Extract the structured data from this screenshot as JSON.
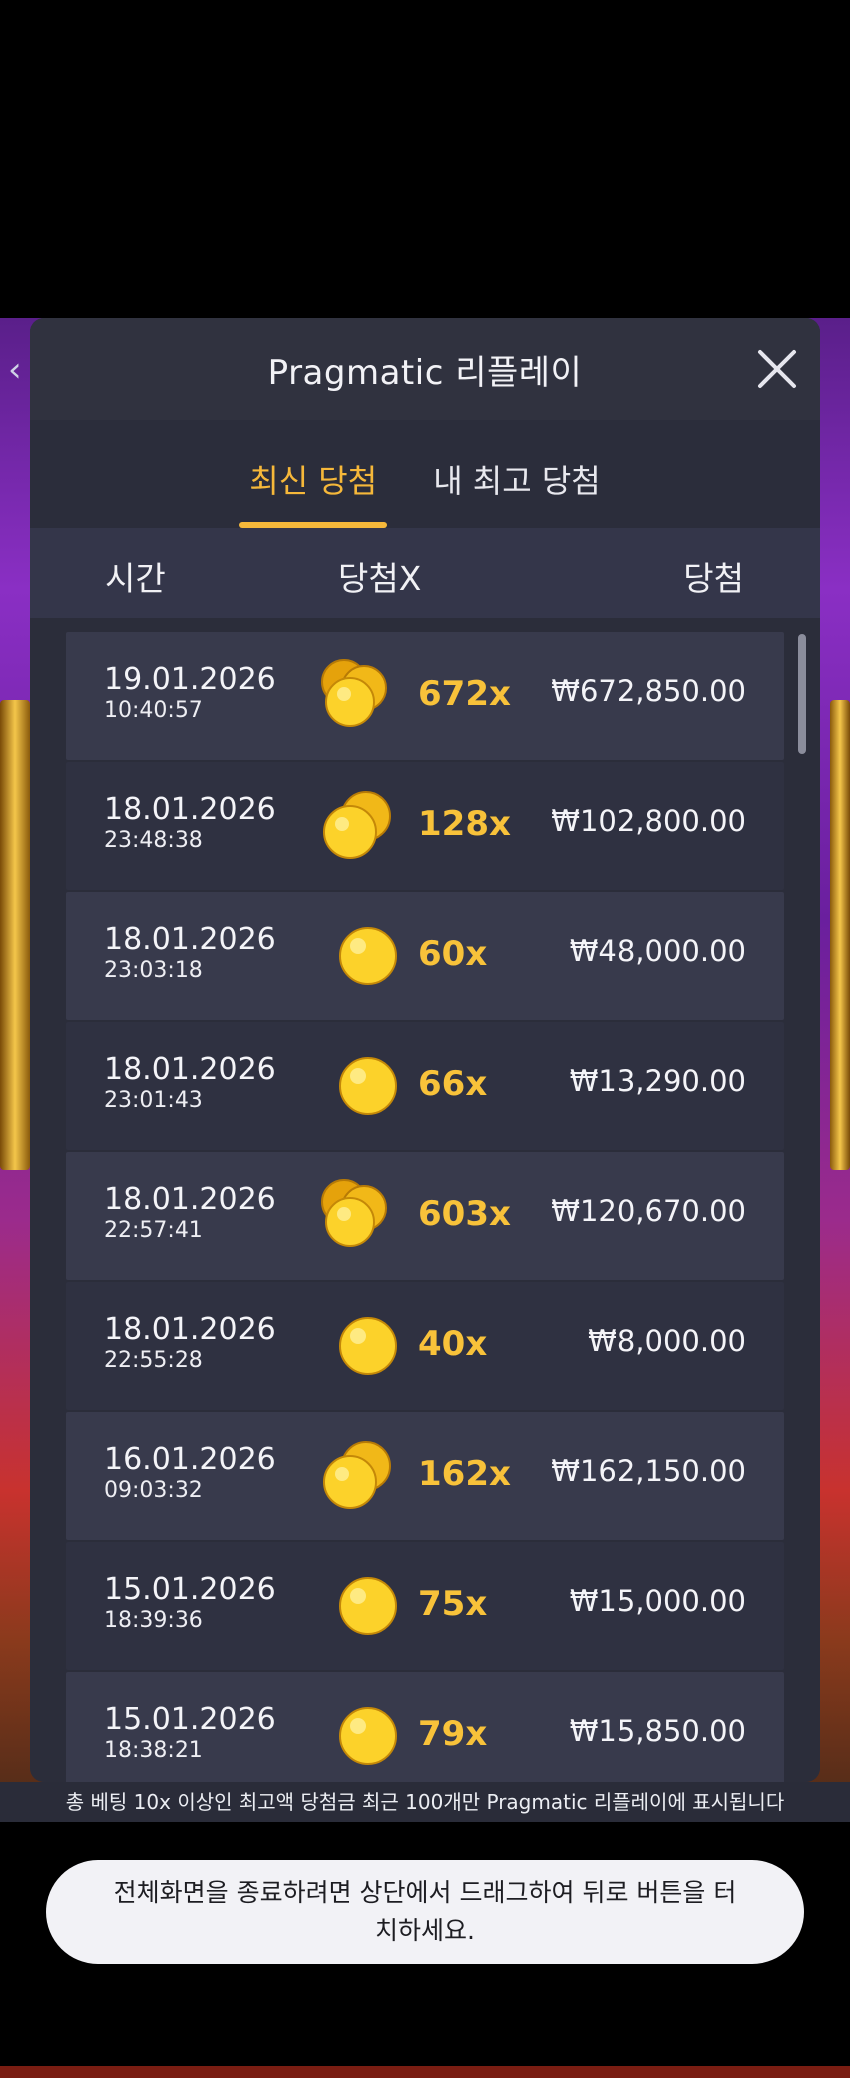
{
  "header": {
    "title": "Pragmatic 리플레이",
    "back_icon": "chevron-left-icon",
    "close_icon": "close-icon"
  },
  "tabs": [
    {
      "label": "최신 당첨",
      "active": true
    },
    {
      "label": "내 최고 당첨",
      "active": false
    }
  ],
  "columns": {
    "time": "시간",
    "multiplier": "당첨X",
    "win": "당첨"
  },
  "rows": [
    {
      "date": "19.01.2026",
      "time": "10:40:57",
      "multiplier": "672x",
      "amount": "₩672,850.00",
      "coins": "three-coins-icon"
    },
    {
      "date": "18.01.2026",
      "time": "23:48:38",
      "multiplier": "128x",
      "amount": "₩102,800.00",
      "coins": "two-coins-icon"
    },
    {
      "date": "18.01.2026",
      "time": "23:03:18",
      "multiplier": "60x",
      "amount": "₩48,000.00",
      "coins": "coin-icon"
    },
    {
      "date": "18.01.2026",
      "time": "23:01:43",
      "multiplier": "66x",
      "amount": "₩13,290.00",
      "coins": "coin-icon"
    },
    {
      "date": "18.01.2026",
      "time": "22:57:41",
      "multiplier": "603x",
      "amount": "₩120,670.00",
      "coins": "three-coins-icon"
    },
    {
      "date": "18.01.2026",
      "time": "22:55:28",
      "multiplier": "40x",
      "amount": "₩8,000.00",
      "coins": "coin-icon"
    },
    {
      "date": "16.01.2026",
      "time": "09:03:32",
      "multiplier": "162x",
      "amount": "₩162,150.00",
      "coins": "two-coins-icon"
    },
    {
      "date": "15.01.2026",
      "time": "18:39:36",
      "multiplier": "75x",
      "amount": "₩15,000.00",
      "coins": "coin-icon"
    },
    {
      "date": "15.01.2026",
      "time": "18:38:21",
      "multiplier": "79x",
      "amount": "₩15,850.00",
      "coins": "coin-icon"
    }
  ],
  "footer_note": "총 베팅 10x 이상인 최고액 당첨금 최근 100개만 Pragmatic 리플레이에 표시됩니다",
  "toast": "전체화면을 종료하려면 상단에서 드래그하여 뒤로 버튼을 터치하세요.",
  "colors": {
    "accent": "#f6b83a",
    "multiplier": "#f8c23a",
    "panel": "#2e3042"
  }
}
